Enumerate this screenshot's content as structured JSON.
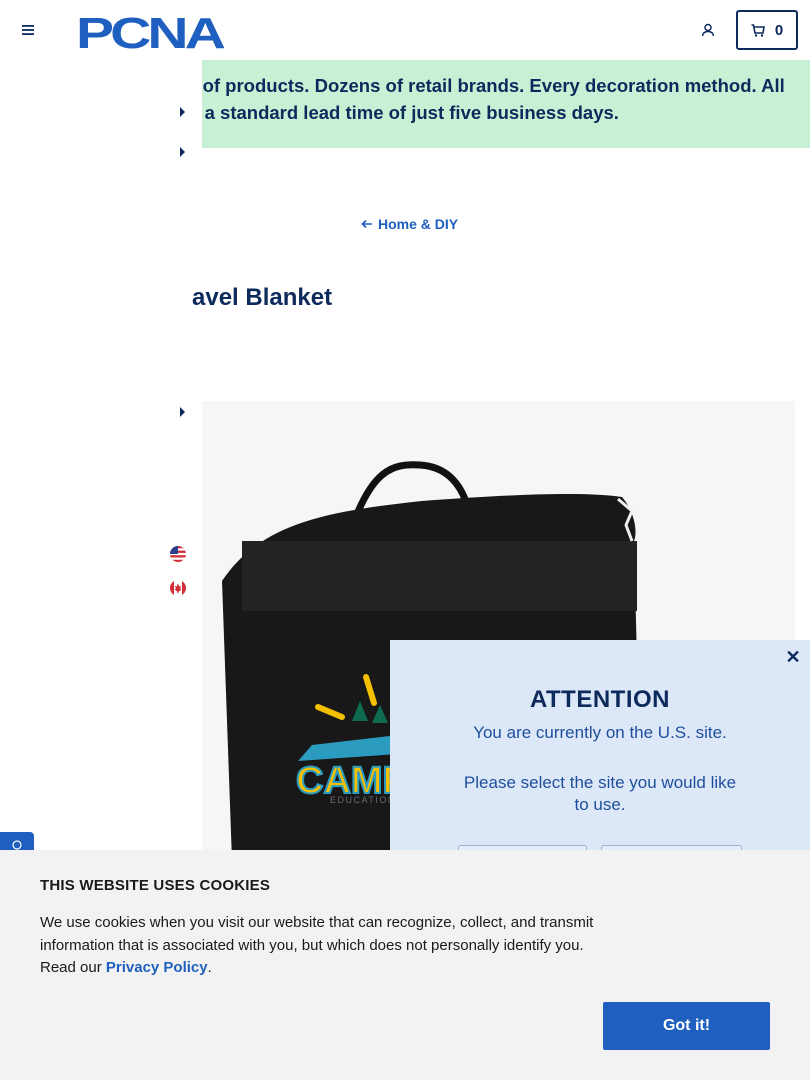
{
  "header": {
    "logo_text": "PCNA",
    "cart_count": "0"
  },
  "banner": {
    "line1": "ls of products. Dozens of retail brands. Every decoration method. All",
    "line2": "th a standard lead time of just five business days."
  },
  "breadcrumb": {
    "label": "Home & DIY"
  },
  "product": {
    "title": "avel Blanket",
    "logo_text": "CAMP",
    "logo_subtext": "EDUCATION"
  },
  "region_modal": {
    "title": "ATTENTION",
    "line1": "You are currently on the U.S. site.",
    "line2": "Please select the site you would like to use."
  },
  "cookie_banner": {
    "title": "THIS WEBSITE USES COOKIES",
    "body": "We use cookies when you visit our website that can recognize, collect, and transmit information that is associated with you, but which does not personally identify you. Read our ",
    "link": "Privacy Policy",
    "suffix": ".",
    "button": "Got it!"
  },
  "colors": {
    "navy": "#0d2a5c",
    "accent_blue": "#1f5fbf",
    "banner_green": "#c6f1d4",
    "modal_bg": "#dce7f7",
    "cookie_bg": "#f2f2f2"
  },
  "icons": [
    "menu-icon",
    "user-icon",
    "cart-icon",
    "arrow-left-icon",
    "close-icon",
    "us-flag-icon",
    "canada-flag-icon",
    "accessibility-icon",
    "caret-right-icon"
  ]
}
